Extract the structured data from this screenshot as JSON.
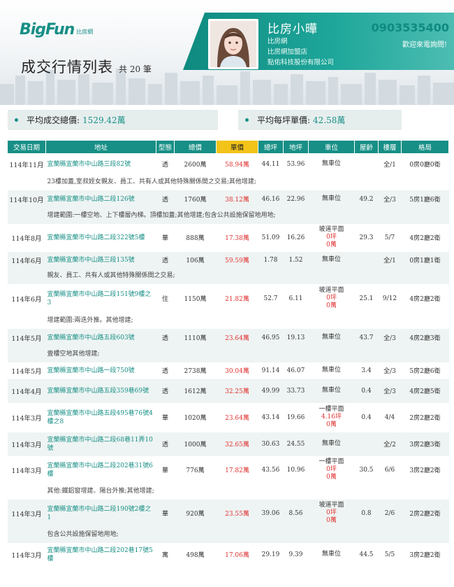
{
  "brand": {
    "logo": "BigFun",
    "logo_sub": "比房網"
  },
  "page": {
    "title": "成交行情列表",
    "count": "共 20 筆"
  },
  "agent": {
    "name": "比房小曄",
    "lines": [
      "比房網",
      "比房網加盟店",
      "點佑科技股份有限公司"
    ],
    "phone": "0903535400",
    "welcome": "歡迎來電詢問!"
  },
  "summary": {
    "avg_total_label": "平均成交總價:",
    "avg_total_value": "1529.42萬",
    "avg_unit_label": "平均每坪單價:",
    "avg_unit_value": "42.58萬"
  },
  "columns": [
    "交易日期",
    "地址",
    "型態",
    "總價",
    "單價",
    "總坪",
    "地坪",
    "車位",
    "屋齡",
    "樓層",
    "格局"
  ],
  "rows": [
    {
      "date": "114年11月",
      "addr": "宜蘭縣宜蘭市中山路三段82號",
      "type": "透",
      "total": "2600萬",
      "unit": "58.94萬",
      "area": "44.11",
      "land": "53.96",
      "parking": [
        "無車位"
      ],
      "age": "",
      "floor": "全/1",
      "layout": "0房0廳0衛",
      "note": "23樓加蓋,室叔姪女親友、員工、共有人或其他特殊關係間之交易;其他增建;"
    },
    {
      "date": "114年10月",
      "addr": "宜蘭縣宜蘭市中山路二段126號",
      "type": "透",
      "total": "1760萬",
      "unit": "38.12萬",
      "area": "46.16",
      "land": "22.96",
      "parking": [
        "無車位"
      ],
      "age": "49.2",
      "floor": "全/3",
      "layout": "5房1廳6衛",
      "note": "增建範圍:一樓空地、上下樓層內梯。頂樓加蓋;其他增建;包含公共設施保留地用地;"
    },
    {
      "date": "114年8月",
      "addr": "宜蘭縣宜蘭市中山路二段322號5樓",
      "type": "華",
      "total": "888萬",
      "unit": "17.38萬",
      "area": "51.09",
      "land": "16.26",
      "parking": [
        "坡道平面",
        "0坪",
        "0萬"
      ],
      "age": "29.3",
      "floor": "5/7",
      "layout": "4房2廳2衛",
      "note": ""
    },
    {
      "date": "114年6月",
      "addr": "宜蘭縣宜蘭市中山路三段135號",
      "type": "透",
      "total": "106萬",
      "unit": "59.59萬",
      "area": "1.78",
      "land": "1.52",
      "parking": [
        "無車位"
      ],
      "age": "",
      "floor": "全/1",
      "layout": "0房1廳1衛",
      "note": "親友、員工、共有人或其他特殊關係間之交易;"
    },
    {
      "date": "114年6月",
      "addr": "宜蘭縣宜蘭市中山路二段151號9樓之3",
      "type": "住",
      "total": "1150萬",
      "unit": "21.82萬",
      "area": "52.7",
      "land": "6.11",
      "parking": [
        "坡道平面",
        "0坪",
        "0萬"
      ],
      "age": "25.1",
      "floor": "9/12",
      "layout": "4房2廳2衛",
      "note": "增建範圍:兩迭外推。其他增建;"
    },
    {
      "date": "114年5月",
      "addr": "宜蘭縣宜蘭市中山路五段603號",
      "type": "透",
      "total": "1110萬",
      "unit": "23.64萬",
      "area": "46.95",
      "land": "19.13",
      "parking": [
        "無車位"
      ],
      "age": "43.7",
      "floor": "全/3",
      "layout": "4房2廳3衛",
      "note": "壹樓空地其他增建;"
    },
    {
      "date": "114年5月",
      "addr": "宜蘭縣宜蘭市中山路一段750號",
      "type": "透",
      "total": "2738萬",
      "unit": "30.04萬",
      "area": "91.14",
      "land": "46.07",
      "parking": [
        "無車位"
      ],
      "age": "3.4",
      "floor": "全/3",
      "layout": "5房2廳6衛",
      "note": ""
    },
    {
      "date": "114年4月",
      "addr": "宜蘭縣宜蘭市中山路五段359巷69號",
      "type": "透",
      "total": "1612萬",
      "unit": "32.25萬",
      "area": "49.99",
      "land": "33.73",
      "parking": [
        "無車位"
      ],
      "age": "0.4",
      "floor": "全/3",
      "layout": "4房2廳5衛",
      "note": ""
    },
    {
      "date": "114年3月",
      "addr": "宜蘭縣宜蘭市中山路五段495巷76號4樓之8",
      "type": "華",
      "total": "1020萬",
      "unit": "23.64萬",
      "area": "43.14",
      "land": "19.66",
      "parking": [
        "一樓平面",
        "4.16坪",
        "0萬"
      ],
      "age": "0.4",
      "floor": "4/4",
      "layout": "2房2廳2衛",
      "note": ""
    },
    {
      "date": "114年3月",
      "addr": "宜蘭縣宜蘭市中山路二段68巷11弄10號",
      "type": "透",
      "total": "1000萬",
      "unit": "32.65萬",
      "area": "30.63",
      "land": "24.55",
      "parking": [
        "無車位"
      ],
      "age": "",
      "floor": "全/2",
      "layout": "3房2廳3衛",
      "note": ""
    },
    {
      "date": "114年3月",
      "addr": "宜蘭縣宜蘭市中山路二段202巷31號6樓",
      "type": "華",
      "total": "776萬",
      "unit": "17.82萬",
      "area": "43.56",
      "land": "10.96",
      "parking": [
        "一樓平面",
        "0坪",
        "0萬"
      ],
      "age": "30.5",
      "floor": "6/6",
      "layout": "3房2廳2衛",
      "note": "其他:鐵鋁窗增建、陽台外推;其他增建;"
    },
    {
      "date": "114年3月",
      "addr": "宜蘭縣宜蘭市中山路二段190號2樓之1",
      "type": "華",
      "total": "920萬",
      "unit": "23.55萬",
      "area": "39.06",
      "land": "8.56",
      "parking": [
        "坡道平面",
        "0坪",
        "0萬"
      ],
      "age": "0.8",
      "floor": "2/6",
      "layout": "2房2廳2衛",
      "note": "包含公共設施保留地用地;"
    },
    {
      "date": "114年3月",
      "addr": "宜蘭縣宜蘭市中山路二段202巷17號5樓",
      "type": "寓",
      "total": "498萬",
      "unit": "17.06萬",
      "area": "29.19",
      "land": "9.39",
      "parking": [
        "無車位"
      ],
      "age": "44.5",
      "floor": "5/5",
      "layout": "3房2廳2衛",
      "note": ""
    }
  ]
}
